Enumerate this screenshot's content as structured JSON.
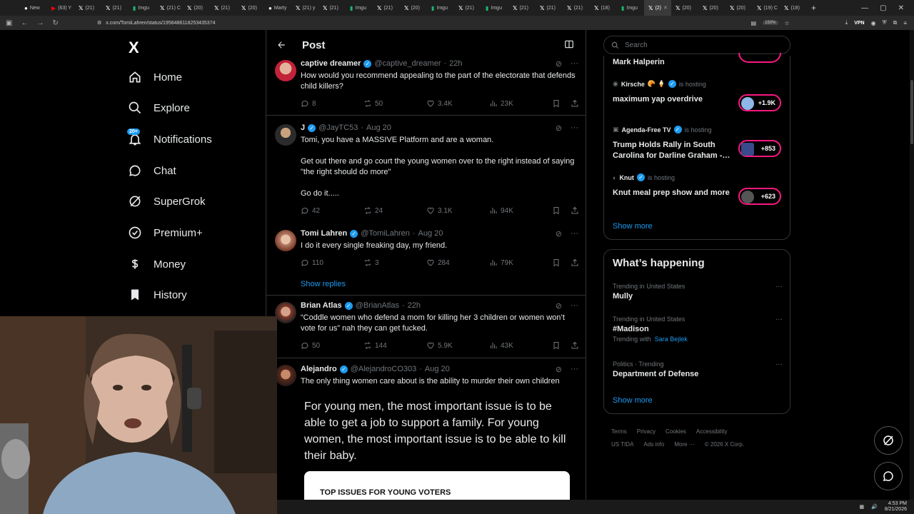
{
  "browser": {
    "tabs": [
      {
        "label": "New",
        "icon": "chrome-icon"
      },
      {
        "label": "(63) Y",
        "icon": "youtube-icon"
      },
      {
        "label": "(21) ",
        "icon": "x-icon"
      },
      {
        "label": "(21) ",
        "icon": "x-icon"
      },
      {
        "label": "Imgu",
        "icon": "imgur-icon"
      },
      {
        "label": "(21) C",
        "icon": "x-icon"
      },
      {
        "label": "(20) ",
        "icon": "x-icon"
      },
      {
        "label": "(21) ",
        "icon": "x-icon"
      },
      {
        "label": "(20) ",
        "icon": "x-icon"
      },
      {
        "label": "Marty",
        "icon": "web-icon"
      },
      {
        "label": "(21) y",
        "icon": "x-icon"
      },
      {
        "label": "(21) ",
        "icon": "x-icon"
      },
      {
        "label": "Imgu",
        "icon": "imgur-icon"
      },
      {
        "label": "(21) ",
        "icon": "x-icon"
      },
      {
        "label": "(20) ",
        "icon": "x-icon"
      },
      {
        "label": "Imgu",
        "icon": "imgur-icon"
      },
      {
        "label": "(21) ",
        "icon": "x-icon"
      },
      {
        "label": "Imgu",
        "icon": "imgur-icon"
      },
      {
        "label": "(21) ",
        "icon": "x-icon"
      },
      {
        "label": "(21) ",
        "icon": "x-icon"
      },
      {
        "label": "(21) ",
        "icon": "x-icon"
      },
      {
        "label": "(18) ",
        "icon": "x-icon"
      },
      {
        "label": "Imgu",
        "icon": "imgur-icon"
      },
      {
        "label": "(2)",
        "icon": "x-icon",
        "active": true
      },
      {
        "label": "(20) ",
        "icon": "x-icon"
      },
      {
        "label": "(20) ",
        "icon": "x-icon"
      },
      {
        "label": "(20) ",
        "icon": "x-icon"
      },
      {
        "label": "(19) C",
        "icon": "x-icon"
      },
      {
        "label": "(18) ",
        "icon": "x-icon"
      }
    ],
    "url": "x.com/TomiLahren/status/1958488118253435374",
    "zoom": "150%",
    "vpn_label": "VPN"
  },
  "nav": {
    "logo": "X",
    "items": [
      {
        "label": "Home",
        "icon": "home-icon"
      },
      {
        "label": "Explore",
        "icon": "search-icon"
      },
      {
        "label": "Notifications",
        "icon": "bell-icon",
        "badge": "20+"
      },
      {
        "label": "Chat",
        "icon": "chat-icon"
      },
      {
        "label": "SuperGrok",
        "icon": "grok-icon"
      },
      {
        "label": "Premium+",
        "icon": "premium-icon"
      },
      {
        "label": "Money",
        "icon": "money-icon"
      },
      {
        "label": "History",
        "icon": "bookmark-icon"
      }
    ]
  },
  "post_header": {
    "title": "Post"
  },
  "tweets": [
    {
      "name": "captive dreamer",
      "handle": "@captive_dreamer",
      "time": "22h",
      "text": "How would you recommend appealing to the part of the electorate that defends child killers?",
      "replies": "8",
      "reposts": "50",
      "likes": "3.4K",
      "views": "23K"
    },
    {
      "name": "J",
      "handle": "@JayTC53",
      "time": "Aug 20",
      "text": "Tomi, you have a MASSIVE Platform and are a woman.",
      "text2": "Get out there and go court the young women over to the right instead of saying \"the right should do more\"",
      "text3": "Go do it.....",
      "replies": "42",
      "reposts": "24",
      "likes": "3.1K",
      "views": "94K"
    },
    {
      "name": "Tomi Lahren",
      "handle": "@TomiLahren",
      "time": "Aug 20",
      "text": "I do it every single freaking day, my friend.",
      "replies": "110",
      "reposts": "3",
      "likes": "284",
      "views": "79K",
      "show_replies": "Show replies"
    },
    {
      "name": "Brian Atlas",
      "handle": "@BrianAtlas",
      "time": "22h",
      "text": "“Coddle women who defend a mom for killing her 3 children or women won’t vote for us” nah they can get fucked.",
      "replies": "50",
      "reposts": "144",
      "likes": "5.9K",
      "views": "43K"
    },
    {
      "name": "Alejandro",
      "handle": "@AlejandroCO303",
      "time": "Aug 20",
      "text": "The only thing women care about is the ability to murder their own children",
      "quote": "For young men, the most important issue is to be able to get a job to support a family. For young women, the most important issue is to be able to kill their baby.",
      "card_title": "TOP ISSUES FOR YOUNG VOTERS"
    }
  ],
  "right": {
    "search_placeholder": "Search",
    "spaces": [
      {
        "title": "Mark Halperin"
      },
      {
        "host": "Kirsche",
        "status": "is hosting",
        "title": "maximum yap overdrive",
        "count": "+1.9K"
      },
      {
        "host": "Agenda-Free TV",
        "status": "is hosting",
        "title": "Trump Holds Rally in South Carolina for Darline Graham -…",
        "count": "+853"
      },
      {
        "host": "Knut",
        "status": "is hosting",
        "title": "Knut meal prep show and more",
        "count": "+623"
      }
    ],
    "spaces_show_more": "Show more",
    "whats_happening": "What’s happening",
    "trends": [
      {
        "context": "Trending in United States",
        "name": "Mully"
      },
      {
        "context": "Trending in United States",
        "name": "#Madison",
        "with_label": "Trending with",
        "with_name": "Sara Bejlek"
      },
      {
        "context": "Politics · Trending",
        "name": "Department of Defense"
      }
    ],
    "trends_show_more": "Show more",
    "footer": [
      "Terms",
      "Privacy",
      "Cookies",
      "Accessibility",
      "US TIDA",
      "Ads info",
      "More ···",
      "© 2026 X Corp."
    ]
  },
  "taskbar": {
    "time": "4:53 PM",
    "date": "8/21/2026"
  }
}
